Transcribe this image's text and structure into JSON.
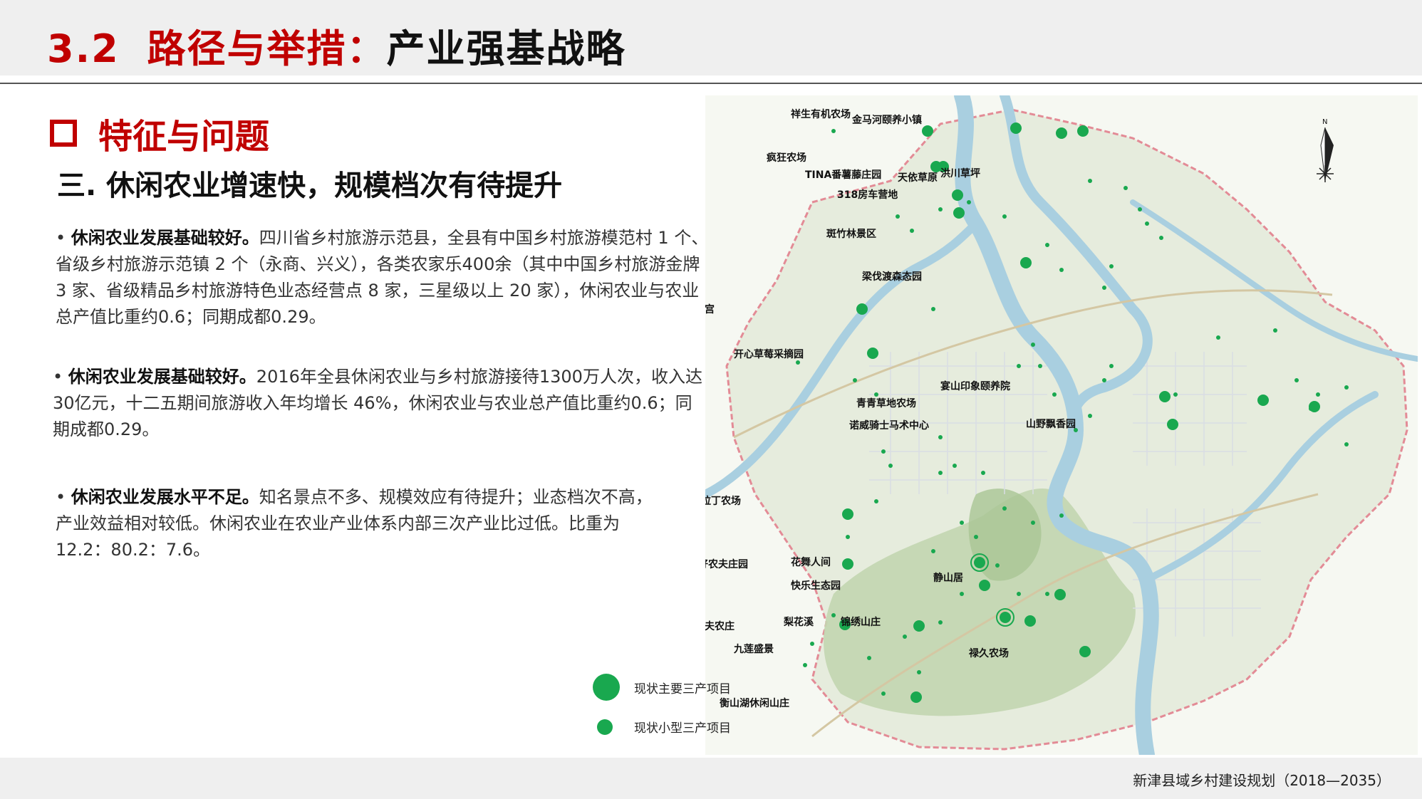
{
  "header": {
    "number": "3.2",
    "title_red": "路径与举措：",
    "title_black": "产业强基战略"
  },
  "section": {
    "title": "特征与问题"
  },
  "subtitle": "三. 休闲农业增速快，规模档次有待提升",
  "paragraphs": [
    {
      "bullet": "•",
      "lead": "休闲农业发展基础较好。",
      "body": "四川省乡村旅游示范县，全县有中国乡村旅游模范村 1 个、省级乡村旅游示范镇 2 个（永商、兴义），各类农家乐400余（其中中国乡村旅游金牌 3 家、省级精品乡村旅游特色业态经营点 8 家，三星级以上 20 家），休闲农业与农业总产值比重约0.6；同期成都0.29。"
    },
    {
      "bullet": "•",
      "lead": "休闲农业发展基础较好。",
      "body": "2016年全县休闲农业与乡村旅游接待1300万人次，收入达30亿元，十二五期间旅游收入年均增长 46%，休闲农业与农业总产值比重约0.6；同期成都0.29。"
    },
    {
      "bullet": "•",
      "lead": "休闲农业发展水平不足。",
      "body": "知名景点不多、规模效应有待提升；业态档次不高，产业效益相对较低。休闲农业在农业产业体系内部三次产业比过低。比重为 12.2：80.2：7.6。"
    }
  ],
  "map": {
    "north_label": "N",
    "colors": {
      "marker": "#19a84f",
      "river": "#a9cfe0",
      "boundary": "#e38b96",
      "land": "#e4eadc",
      "hills": "#b8cfa6"
    },
    "places": [
      {
        "name": "祥生有机农场",
        "size": "major"
      },
      {
        "name": "金马河颐养小镇",
        "size": "major"
      },
      {
        "name": "疯狂农场",
        "size": "major"
      },
      {
        "name": "TINA番薯藤庄园",
        "size": "major"
      },
      {
        "name": "天依草原",
        "size": "major"
      },
      {
        "name": "洪川草坪",
        "size": "major"
      },
      {
        "name": "318房车营地",
        "size": "major"
      },
      {
        "name": "斑竹林景区",
        "size": "major"
      },
      {
        "name": "梁伐渡森态园",
        "size": "major"
      },
      {
        "name": "玉米迷宫",
        "size": "major"
      },
      {
        "name": "开心草莓采摘园",
        "size": "major"
      },
      {
        "name": "青青草地农场",
        "size": "major"
      },
      {
        "name": "诺威骑士马术中心",
        "size": "major"
      },
      {
        "name": "宴山印象颐养院",
        "size": "major"
      },
      {
        "name": "山野飘香园",
        "size": "major"
      },
      {
        "name": "阿拉丁农场",
        "size": "major"
      },
      {
        "name": "好农夫庄园",
        "size": "major"
      },
      {
        "name": "花舞人间",
        "size": "major"
      },
      {
        "name": "快乐生态园",
        "size": "major"
      },
      {
        "name": "静山居",
        "size": "major"
      },
      {
        "name": "渔夫农庄",
        "size": "major"
      },
      {
        "name": "九莲盛景",
        "size": "major"
      },
      {
        "name": "梨花溪",
        "size": "major"
      },
      {
        "name": "锦绣山庄",
        "size": "major"
      },
      {
        "name": "禄久农场",
        "size": "major"
      },
      {
        "name": "衡山湖休闲山庄",
        "size": "major"
      }
    ]
  },
  "legend": [
    {
      "label": "现状主要三产项目",
      "size": "large"
    },
    {
      "label": "现状小型三产项目",
      "size": "small"
    }
  ],
  "footer": {
    "text": "新津县域乡村建设规划（2018—2035）"
  }
}
